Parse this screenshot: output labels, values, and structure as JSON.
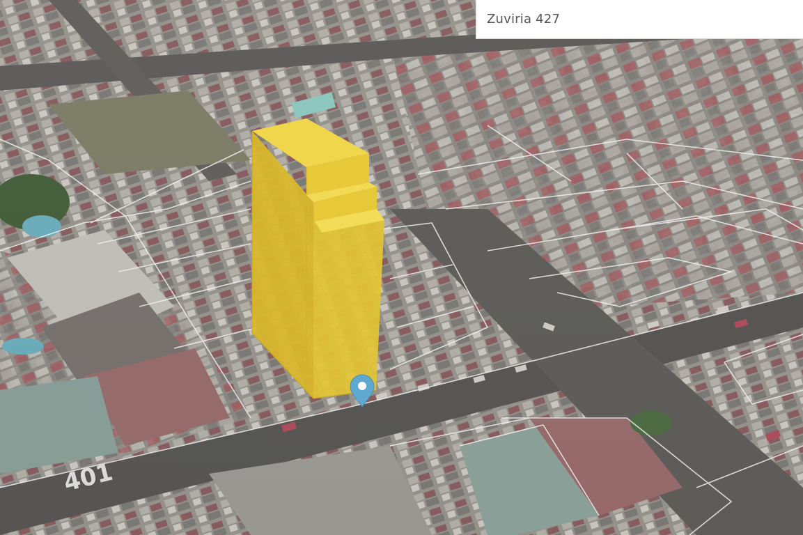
{
  "search": {
    "value": "Zuviria 427"
  },
  "map": {
    "road_marking": "401",
    "colors": {
      "building_massing": "#e5c632",
      "marker": "#5fa8cf",
      "parcel_lines": "#ffffff"
    },
    "icons": {
      "location_marker": "map-pin-icon"
    }
  }
}
